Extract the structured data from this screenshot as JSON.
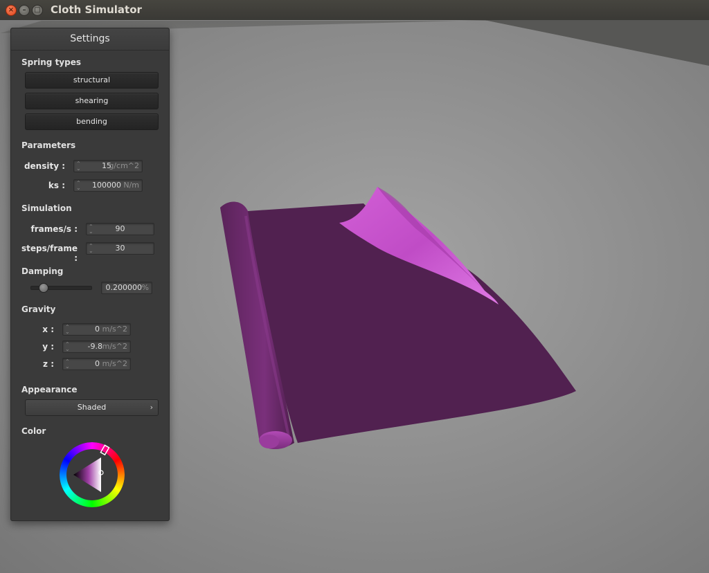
{
  "window": {
    "title": "Cloth Simulator"
  },
  "panel": {
    "title": "Settings",
    "spring_types": {
      "heading": "Spring types",
      "buttons": [
        "structural",
        "shearing",
        "bending"
      ]
    },
    "parameters": {
      "heading": "Parameters",
      "density": {
        "label": "density :",
        "value": "15",
        "unit": "g/cm^2"
      },
      "ks": {
        "label": "ks :",
        "value": "100000",
        "unit": "N/m"
      }
    },
    "simulation": {
      "heading": "Simulation",
      "fps": {
        "label": "frames/s :",
        "value": "90"
      },
      "steps": {
        "label": "steps/frame :",
        "value": "30"
      }
    },
    "damping": {
      "heading": "Damping",
      "slider_value": 0.2,
      "value": "0.200000",
      "unit": "%"
    },
    "gravity": {
      "heading": "Gravity",
      "x": {
        "label": "x :",
        "value": "0",
        "unit": "m/s^2"
      },
      "y": {
        "label": "y :",
        "value": "-9.8",
        "unit": "m/s^2"
      },
      "z": {
        "label": "z :",
        "value": "0",
        "unit": "m/s^2"
      }
    },
    "appearance": {
      "heading": "Appearance",
      "selected": "Shaded"
    },
    "color": {
      "heading": "Color",
      "current": "#c94fc9"
    }
  },
  "colors": {
    "cloth_main": "#512150",
    "cloth_highlight": "#c94fc9",
    "viewport_bg": "#8f8f8f"
  }
}
